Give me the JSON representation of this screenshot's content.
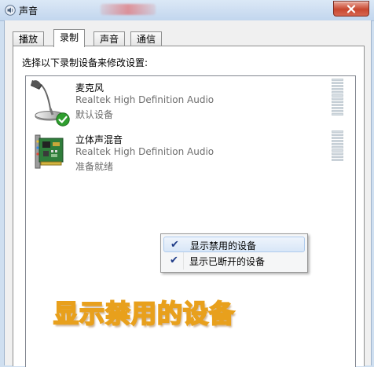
{
  "window": {
    "title": "声音",
    "title_icon": "speaker-icon",
    "close_icon": "close-icon"
  },
  "tabs": [
    {
      "label": "播放",
      "active": false
    },
    {
      "label": "录制",
      "active": true
    },
    {
      "label": "声音",
      "active": false
    },
    {
      "label": "通信",
      "active": false
    }
  ],
  "panel": {
    "instruction": "选择以下录制设备来修改设置:"
  },
  "devices": [
    {
      "name": "麦克风",
      "driver": "Realtek High Definition Audio",
      "status": "默认设备",
      "icon": "microphone-icon",
      "is_default": true
    },
    {
      "name": "立体声混音",
      "driver": "Realtek High Definition Audio",
      "status": "准备就绪",
      "icon": "sound-card-icon",
      "is_default": false
    }
  ],
  "context_menu": {
    "items": [
      {
        "label": "显示禁用的设备",
        "checked": true,
        "highlighted": true
      },
      {
        "label": "显示已断开的设备",
        "checked": true,
        "highlighted": false
      }
    ]
  },
  "overlay": {
    "caption": "显示禁用的设备"
  },
  "colors": {
    "title_bar": "#c8dbf0",
    "close_button": "#c8472f",
    "default_check": "#2e9e2e",
    "caption_fill": "#fff3a8",
    "caption_stroke": "#e8a01c"
  }
}
